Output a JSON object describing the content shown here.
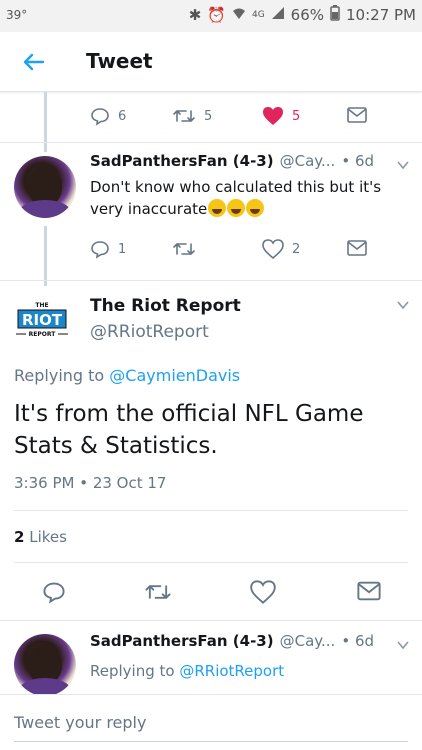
{
  "status_bar": {
    "temperature": "39°",
    "network": "4G",
    "battery": "66%",
    "clock": "10:27 PM"
  },
  "header": {
    "title": "Tweet"
  },
  "parent_actions": {
    "retweets": "5",
    "likes": "5",
    "replies": "6"
  },
  "reply1": {
    "name": "SadPanthersFan (4-3)",
    "handle": "@Cay...",
    "time": "6d",
    "text": "Don't know who calculated this but it's very inaccurate",
    "replies": "1",
    "likes": "2"
  },
  "main_tweet": {
    "name": "The Riot Report",
    "handle": "@RRiotReport",
    "replying_label": "Replying to",
    "replying_to": "@CaymienDavis",
    "text": "It's from the official NFL Game Stats & Statistics.",
    "timestamp": "3:36 PM • 23 Oct 17",
    "likes_count": "2",
    "likes_label": "Likes"
  },
  "reply2": {
    "name": "SadPanthersFan (4-3)",
    "handle": "@Cay...",
    "time": "6d",
    "replying_label": "Replying to",
    "replying_to": "@RRiotReport"
  },
  "reply_box": {
    "placeholder": "Tweet your reply"
  },
  "colors": {
    "accent": "#1da1f2",
    "like": "#e0245e",
    "muted": "#657786"
  }
}
